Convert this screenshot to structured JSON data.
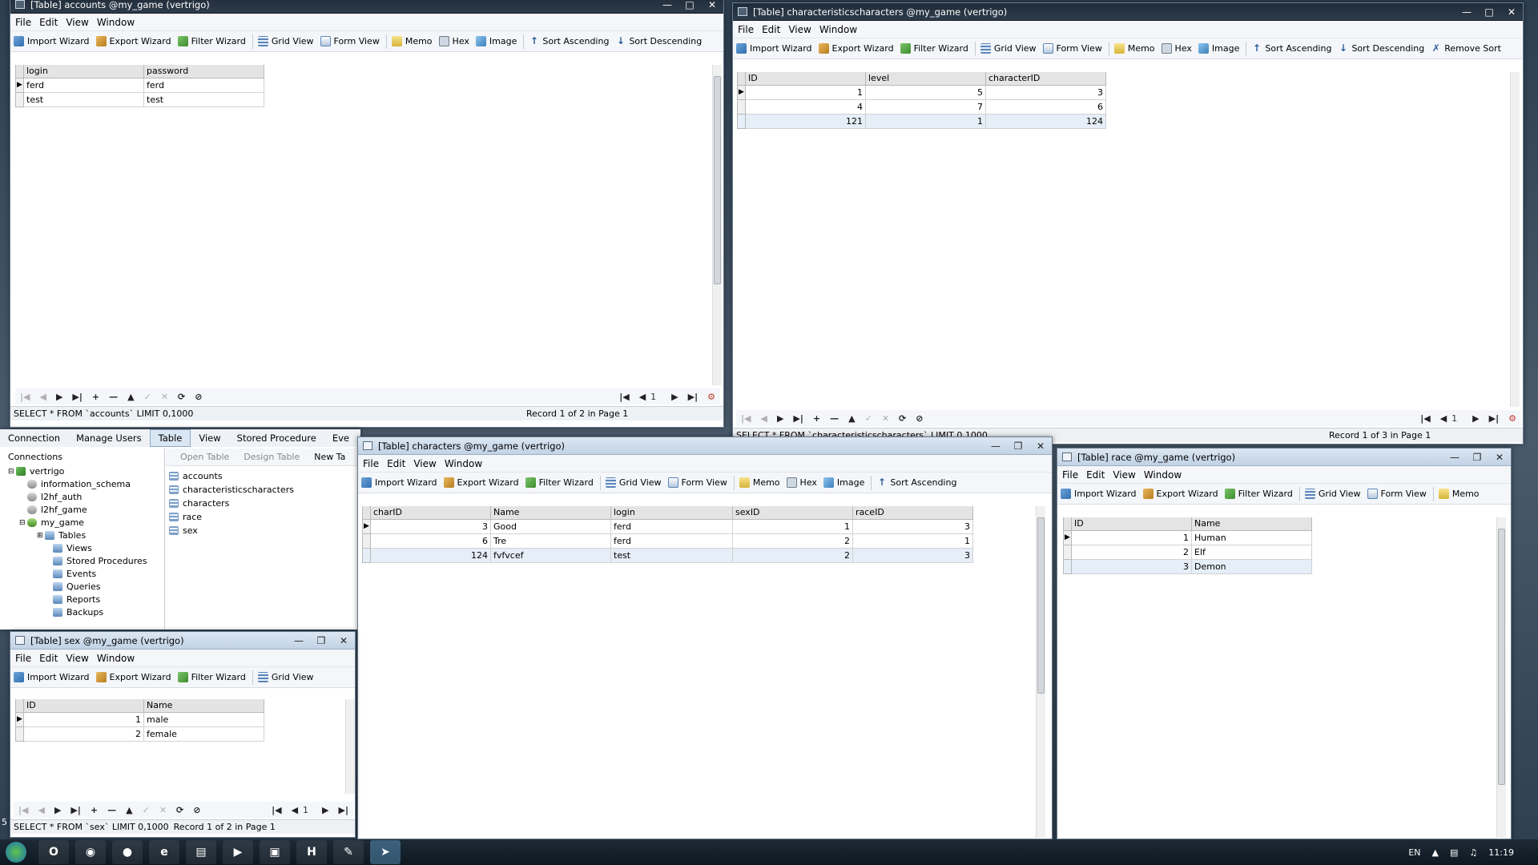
{
  "toolbar_labels": {
    "import": "Import Wizard",
    "export": "Export Wizard",
    "filter": "Filter Wizard",
    "grid": "Grid View",
    "form": "Form View",
    "memo": "Memo",
    "hex": "Hex",
    "image": "Image",
    "sort_asc": "Sort Ascending",
    "sort_desc": "Sort Descending",
    "remove_sort": "Remove Sort"
  },
  "menu": {
    "file": "File",
    "edit": "Edit",
    "view": "View",
    "window": "Window"
  },
  "win_accounts": {
    "title": "[Table] accounts @my_game (vertrigo)",
    "columns": [
      "login",
      "password"
    ],
    "rows": [
      [
        "ferd",
        "ferd"
      ],
      [
        "test",
        "test"
      ]
    ],
    "page": "1",
    "sql": "SELECT * FROM `accounts` LIMIT 0,1000",
    "record": "Record 1 of 2 in Page 1"
  },
  "win_chars_chars": {
    "title": "[Table] characteristicscharacters @my_game (vertrigo)",
    "columns": [
      "ID",
      "level",
      "characterID"
    ],
    "rows": [
      [
        "1",
        "5",
        "3"
      ],
      [
        "4",
        "7",
        "6"
      ],
      [
        "121",
        "1",
        "124"
      ]
    ],
    "page": "1",
    "sql": "SELECT * FROM `characteristicscharacters` LIMIT 0,1000",
    "record": "Record 1 of 3 in Page 1"
  },
  "main_window": {
    "menus": [
      "Connection",
      "Manage Users"
    ],
    "tabs": [
      "Table",
      "View",
      "Stored Procedure",
      "Eve"
    ],
    "connections_label": "Connections",
    "obj_toolbar": {
      "open": "Open Table",
      "design": "Design Table",
      "new": "New Ta"
    },
    "tree": {
      "server": "vertrigo",
      "dbs": [
        "information_schema",
        "l2hf_auth",
        "l2hf_game",
        "my_game"
      ],
      "children": [
        "Tables",
        "Views",
        "Stored Procedures",
        "Events",
        "Queries",
        "Reports",
        "Backups"
      ]
    },
    "tables": [
      "accounts",
      "characteristicscharacters",
      "characters",
      "race",
      "sex"
    ]
  },
  "win_characters": {
    "title": "[Table] characters @my_game (vertrigo)",
    "columns": [
      "charID",
      "Name",
      "login",
      "sexID",
      "raceID"
    ],
    "rows": [
      [
        "3",
        "Good",
        "ferd",
        "1",
        "3"
      ],
      [
        "6",
        "Tre",
        "ferd",
        "2",
        "1"
      ],
      [
        "124",
        "fvfvcef",
        "test",
        "2",
        "3"
      ]
    ]
  },
  "win_race": {
    "title": "[Table] race @my_game (vertrigo)",
    "columns": [
      "ID",
      "Name"
    ],
    "rows": [
      [
        "1",
        "Human"
      ],
      [
        "2",
        "Elf"
      ],
      [
        "3",
        "Demon"
      ]
    ]
  },
  "win_sex": {
    "title": "[Table] sex @my_game (vertrigo)",
    "columns": [
      "ID",
      "Name"
    ],
    "rows": [
      [
        "1",
        "male"
      ],
      [
        "2",
        "female"
      ]
    ],
    "page": "1",
    "sql": "SELECT * FROM `sex` LIMIT 0,1000",
    "record": "Record 1 of 2 in Page 1"
  },
  "taskbar": {
    "lang": "EN",
    "clock": "11:19",
    "side_marker": "5"
  },
  "colors": {
    "selected_row": "#e6eef8",
    "header_bg": "#e4e4e4",
    "taskbar": "#1d2a36"
  }
}
